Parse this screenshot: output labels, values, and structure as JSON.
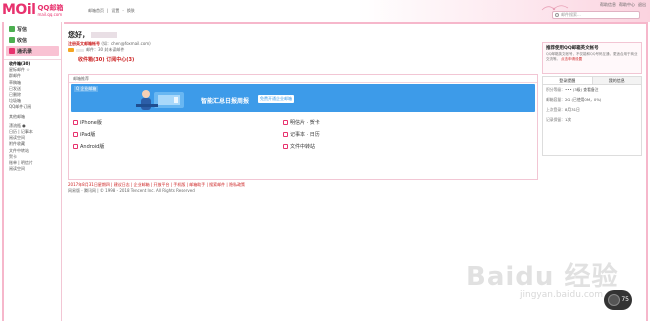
{
  "header": {
    "logo": "QQ邮箱",
    "logo_sub": "QQ邮箱",
    "logo_domain": "mail.qq.com",
    "nav": [
      "邮箱首页",
      "设置",
      "换肤"
    ],
    "links": [
      "帮助信息",
      "帮助中心",
      "退出"
    ],
    "search_placeholder": "邮件搜索..."
  },
  "sidebar": {
    "buttons": [
      {
        "label": "写信",
        "color": "#4caf50"
      },
      {
        "label": "收信",
        "color": "#4caf50"
      },
      {
        "label": "通讯录",
        "color": "#e8326e"
      }
    ],
    "items": [
      {
        "label": "收件箱(30)",
        "bold": true
      },
      {
        "label": "星标邮件 ☆",
        "bold": false
      },
      {
        "label": "群邮件",
        "bold": false
      },
      {
        "label": "草稿箱",
        "bold": false
      },
      {
        "label": "已发送",
        "bold": false
      },
      {
        "label": "已删除",
        "bold": false
      },
      {
        "label": "垃圾箱",
        "bold": false
      },
      {
        "label": "QQ邮件订阅",
        "bold": false
      },
      {
        "label": "其他邮箱",
        "bold": false
      },
      {
        "label": "",
        "bold": false
      },
      {
        "label": "漂流瓶 ●",
        "bold": false
      },
      {
        "label": "日历 | 记事本",
        "bold": false
      },
      {
        "label": "阅读空间",
        "bold": false
      },
      {
        "label": "附件收藏",
        "bold": false
      },
      {
        "label": "文件中转站",
        "bold": false
      },
      {
        "label": "贺卡",
        "bold": false
      },
      {
        "label": "账单 | 明信片",
        "bold": false
      },
      {
        "label": "阅读空间",
        "bold": false
      }
    ]
  },
  "main": {
    "greeting": "您好，",
    "account_label": "注册英文邮箱帐号",
    "account_hint": "(如：chen@foxmail.com)",
    "quota_text": "邮件：30 封未读邮件",
    "counts": "收件箱(30)  订阅中心(3)",
    "panel_title": "邮箱推荐",
    "banner": {
      "logo": "Q 企业邮箱",
      "title": "智能汇总日报周报",
      "button": "免费开通企业邮箱"
    },
    "apps": [
      {
        "label": "iPhone版"
      },
      {
        "label": "iPad版"
      },
      {
        "label": "Android版"
      },
      {
        "label": "明信片 · 贺卡"
      },
      {
        "label": "记事本 · 日历"
      },
      {
        "label": "文件中转站"
      }
    ],
    "footer_line1": "2017年8月31日星期四 | 建议日志 | 企业邮箱 | 开放平台 | 手机版 | 邮箱助手 | 搜索邮件 | 隐私政策",
    "footer_line2": "网易版 - 腾讯网 | © 1998 - 2018 Tencent Inc. All Rights Reserved"
  },
  "notice": {
    "title": "推荐使用QQ邮箱英文帐号",
    "body": "QQ邮箱英文帐号，不仅能和QQ号码互通，更适合用于商业交流等。",
    "link": "点击申请设置"
  },
  "info": {
    "tabs": [
      "登录提醒",
      "我的信息"
    ],
    "rows": [
      {
        "k": "积分等级：",
        "v": "••• (3级) 查看备注"
      },
      {
        "k": "邮箱容量：",
        "v": "2G (已使用0M，0%)"
      },
      {
        "k": "上次登录：",
        "v": "8月31日"
      },
      {
        "k": "记录保留：",
        "v": "1次"
      }
    ]
  },
  "watermark": {
    "main": "Baidu 经验",
    "sub": "jingyan.baidu.com"
  },
  "widget": {
    "value": "75"
  },
  "colors": {
    "brand": "#e8326e",
    "accent": "#3d9be9"
  }
}
